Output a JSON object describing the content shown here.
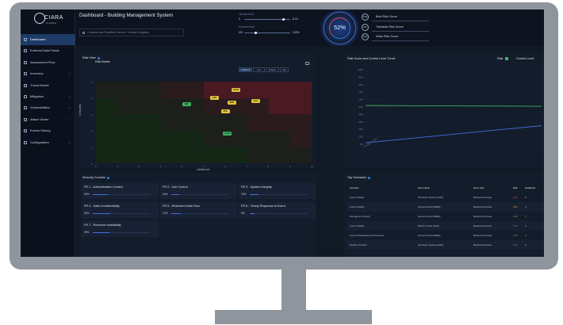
{
  "app": {
    "logo_text": "CIARA",
    "logo_sub": "By Radiflow",
    "page_title": "Dashboard  -  Building Management System",
    "facility_path": "Commercial Facilities Sector / United Kingdom"
  },
  "sidebar": {
    "items": [
      {
        "label": "Dashboard",
        "icon": "grid-icon",
        "active": true,
        "chevron": false
      },
      {
        "label": "External Data Feeds",
        "icon": "feed-icon",
        "active": false,
        "chevron": false
      },
      {
        "label": "Assessment Flow",
        "icon": "flow-icon",
        "active": false,
        "chevron": false
      },
      {
        "label": "Inventory",
        "icon": "inventory-icon",
        "active": false,
        "chevron": true
      },
      {
        "label": "Threat Model",
        "icon": "chart-icon",
        "active": false,
        "chevron": false
      },
      {
        "label": "Mitigation",
        "icon": "gear-icon",
        "active": false,
        "chevron": true
      },
      {
        "label": "Vulnerabilities",
        "icon": "bug-icon",
        "active": false,
        "chevron": true
      },
      {
        "label": "Attack Vector",
        "icon": "vector-icon",
        "active": false,
        "chevron": true
      },
      {
        "label": "Events History",
        "icon": "history-icon",
        "active": false,
        "chevron": false
      },
      {
        "label": "Configuration",
        "icon": "settings-icon",
        "active": false,
        "chevron": true
      }
    ]
  },
  "header": {
    "threat_level": {
      "label": "Threat level",
      "min": "0",
      "max": "$ 15",
      "value": 0.85
    },
    "control_level": {
      "label": "Control level",
      "min": "0%",
      "max": "100%",
      "value": 0.25
    },
    "gauge_value": "52%",
    "scores": [
      {
        "badge": "13%",
        "label": "Best Risk Score"
      },
      {
        "badge": "0%",
        "label": "Tolerable Risk Score"
      },
      {
        "badge": "51%",
        "label": "Initial Risk Score"
      }
    ]
  },
  "risk_view": {
    "label": "Risk View",
    "title": "Risk Matrix",
    "tabs": [
      {
        "label": "Likelihood",
        "on": true
      },
      {
        "label": "Loss",
        "on": false
      },
      {
        "label": "Mitigate",
        "on": false
      },
      {
        "label": "Risk",
        "on": false
      }
    ],
    "xlabel": "Likelihood",
    "ylabel": "Criticality",
    "x_ticks": [
      "0",
      "1",
      "2",
      "3",
      "4",
      "5",
      "6",
      "7",
      "8",
      "9",
      "10"
    ],
    "y_ticks": [
      "0",
      "1",
      "2",
      "3",
      "4",
      "5"
    ],
    "markers": [
      {
        "label": "SBV",
        "x": 4.2,
        "y": 3.6,
        "color": "#3db160"
      },
      {
        "label": "FPS",
        "x": 5.5,
        "y": 4.0,
        "color": "#e3c53a"
      },
      {
        "label": "HVAC",
        "x": 6.5,
        "y": 4.5,
        "color": "#e3c53a"
      },
      {
        "label": "BMS",
        "x": 6.3,
        "y": 3.7,
        "color": "#e3c53a"
      },
      {
        "label": "ACS",
        "x": 7.4,
        "y": 3.8,
        "color": "#e3c53a"
      },
      {
        "label": "PAS",
        "x": 6.0,
        "y": 3.2,
        "color": "#e3c53a"
      },
      {
        "label": "CCTV",
        "x": 6.1,
        "y": 1.8,
        "color": "#3db160"
      }
    ]
  },
  "trend": {
    "title": "Risk Score and Control Level Trend",
    "legend_risk": "Risk",
    "legend_control": "Control Level",
    "risk_color": "#3db160",
    "control_color": "#3f6fe0",
    "y_ticks": [
      "100%",
      "90%",
      "80%",
      "70%",
      "60%",
      "50%",
      "40%",
      "30%",
      "20%",
      "10%",
      "0%"
    ],
    "x_tick": "Thu Apr 13 2023"
  },
  "chart_data": {
    "type": "line",
    "title": "Risk Score and Control Level Trend",
    "xlabel": "",
    "ylabel": "",
    "ylim": [
      0,
      100
    ],
    "x": [
      "Thu Apr 13 2023",
      ""
    ],
    "series": [
      {
        "name": "Risk",
        "values": [
          52,
          51
        ]
      },
      {
        "name": "Control Level",
        "values": [
          2,
          25
        ]
      }
    ]
  },
  "security_controls": {
    "title": "Security Controls",
    "items": [
      {
        "name": "FR 1 - Authentication Control",
        "pct": "26%",
        "value": 0.26
      },
      {
        "name": "FR 2 - Use Control",
        "pct": "14%",
        "value": 0.14
      },
      {
        "name": "FR 3 - System Integrity",
        "pct": "15%",
        "value": 0.15
      },
      {
        "name": "FR 4 - Data Confidentiality",
        "pct": "30%",
        "value": 0.3
      },
      {
        "name": "FR 5 - Restricted Data Flow",
        "pct": "17%",
        "value": 0.17
      },
      {
        "name": "FR 6 - Timely Response to Event",
        "pct": "9%",
        "value": 0.09
      },
      {
        "name": "FR 7 - Resource Availability",
        "pct": "29%",
        "value": 0.29
      }
    ]
  },
  "top_scenarios": {
    "title": "Top Scenarios",
    "columns": [
      "Scenario",
      "Zone Name",
      "Zone Type",
      "Risk",
      "Likelihood",
      "Impact"
    ],
    "rows": [
      [
        "Loss of Safety",
        "Fire Alarm System (FAS)",
        "Business Process",
        "43%",
        "6",
        "4"
      ],
      [
        "Loss of Safety",
        "Access Control (BMS)",
        "Business Process",
        "29%",
        "4",
        "4"
      ],
      [
        "Damage to Property",
        "Access Control (BMS)",
        "Business Process",
        "24%",
        "7",
        "3"
      ],
      [
        "Loss of Safety",
        "HVAC Control (HVS)",
        "Business Process",
        "21%",
        "3",
        "4"
      ],
      [
        "Loss of Productivity and Revenue",
        "Access Control (BMS)",
        "Business Process",
        "18%",
        "4",
        "3"
      ],
      [
        "Denial of Control",
        "Fire Alarm System (FAS)",
        "Business Process",
        "15%",
        "3",
        "3"
      ]
    ],
    "risk_colors": [
      "#e0455b",
      "#e08a3a",
      "#e08a3a",
      "#3db160",
      "#3db160",
      "#3db160"
    ]
  }
}
